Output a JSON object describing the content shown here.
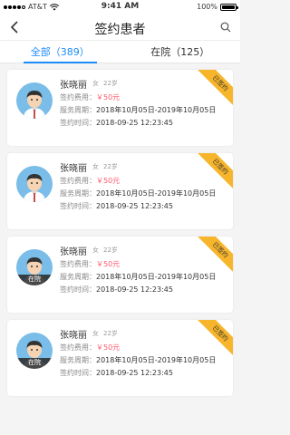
{
  "status_bar": {
    "carrier": "AT&T",
    "time": "9:41 AM",
    "battery": "100%"
  },
  "nav": {
    "title": "签约患者"
  },
  "tabs": [
    {
      "label": "全部（389）",
      "active": true
    },
    {
      "label": "在院（125）",
      "active": false
    }
  ],
  "labels": {
    "fee": "签约费用：",
    "period": "服务周期：",
    "sign_time": "签约时间："
  },
  "patients": [
    {
      "name": "张晓丽",
      "gender": "女",
      "age": "22岁",
      "fee": "￥50元",
      "period": "2018年10月05日-2019年10月05日",
      "sign_time": "2018-09-25  12:23:45",
      "badge": "已签约",
      "avatar": "doctor-avatar",
      "tag": ""
    },
    {
      "name": "张晓丽",
      "gender": "女",
      "age": "22岁",
      "fee": "￥50元",
      "period": "2018年10月05日-2019年10月05日",
      "sign_time": "2018-09-25  12:23:45",
      "badge": "已签约",
      "avatar": "doctor-avatar",
      "tag": ""
    },
    {
      "name": "张晓丽",
      "gender": "女",
      "age": "22岁",
      "fee": "￥50元",
      "period": "2018年10月05日-2019年10月05日",
      "sign_time": "2018-09-25  12:23:45",
      "badge": "已签约",
      "avatar": "patient-avatar",
      "tag": "在院"
    },
    {
      "name": "张晓丽",
      "gender": "女",
      "age": "22岁",
      "fee": "￥50元",
      "period": "2018年10月05日-2019年10月05日",
      "sign_time": "2018-09-25  12:23:45",
      "badge": "已签约",
      "avatar": "patient-avatar",
      "tag": "在院"
    }
  ],
  "colors": {
    "accent": "#1d8cf8",
    "price": "#ff5a6e",
    "badge": "#f7b52c",
    "avatar_bg": "#79bde8"
  }
}
